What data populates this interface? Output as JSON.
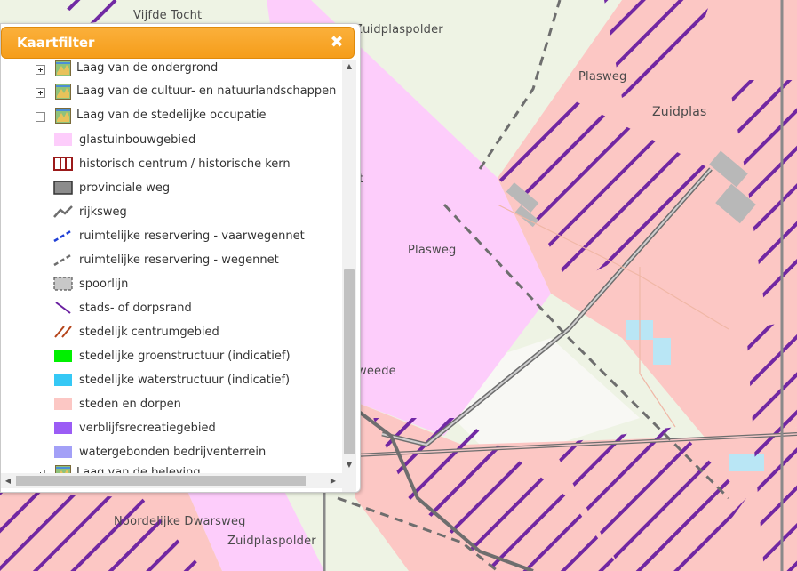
{
  "panel": {
    "title": "Kaartfilter",
    "close_glyph": "✖",
    "groups": [
      {
        "label": "Laag van de ondergrond",
        "expanded": false
      },
      {
        "label": "Laag van de cultuur- en natuurlandschappen",
        "expanded": false
      },
      {
        "label": "Laag van de stedelijke occupatie",
        "expanded": true
      },
      {
        "label": "Laag van de beleving",
        "expanded": false
      }
    ],
    "legend_items": [
      {
        "label": "glastuinbouwgebied",
        "symbol": "fill",
        "color": "#fdcdfb"
      },
      {
        "label": "historisch centrum / historische kern",
        "symbol": "hatch-box",
        "color": "#9b1a1a"
      },
      {
        "label": "provinciale weg",
        "symbol": "fill-border",
        "color": "#8c8c8c"
      },
      {
        "label": "rijksweg",
        "symbol": "zigzag",
        "color": "#6e6e6e"
      },
      {
        "label": "ruimtelijke reservering - vaarwegennet",
        "symbol": "dash-line",
        "color": "#1f3fd6"
      },
      {
        "label": "ruimtelijke reservering - wegennet",
        "symbol": "dash-line",
        "color": "#6e6e6e"
      },
      {
        "label": "spoorlijn",
        "symbol": "dash-box",
        "color": "#c8c8c8"
      },
      {
        "label": "stads- of dorpsrand",
        "symbol": "diag",
        "color": "#6a1fa0"
      },
      {
        "label": "stedelijk centrumgebied",
        "symbol": "diag-double",
        "color": "#b5451b"
      },
      {
        "label": "stedelijke groenstructuur (indicatief)",
        "symbol": "fill",
        "color": "#00f000"
      },
      {
        "label": "stedelijke waterstructuur (indicatief)",
        "symbol": "fill",
        "color": "#35c8f5"
      },
      {
        "label": "steden en dorpen",
        "symbol": "fill",
        "color": "#fcc7c4"
      },
      {
        "label": "verblijfsrecreatiegebied",
        "symbol": "fill",
        "color": "#9b5cf5"
      },
      {
        "label": "watergebonden bedrijventerrein",
        "symbol": "fill",
        "color": "#a3a0f7"
      }
    ]
  },
  "map": {
    "labels": [
      {
        "text": "Vijfde Tocht"
      },
      {
        "text": "Zuidplaspolder"
      },
      {
        "text": "Plasweg"
      },
      {
        "text": "Zuidplas"
      },
      {
        "text": "Plasweg"
      },
      {
        "text": "Noordelijke Dwarsweg"
      },
      {
        "text": "Zuidplaspolder"
      },
      {
        "text": "weede"
      },
      {
        "text": "t"
      }
    ],
    "colors": {
      "background": "#eef3e4",
      "glastuinbouw": "#fdcdfb",
      "steden": "#fcc7c4",
      "hatch": "#6a1fa0",
      "road": "#6e6e6e"
    }
  }
}
